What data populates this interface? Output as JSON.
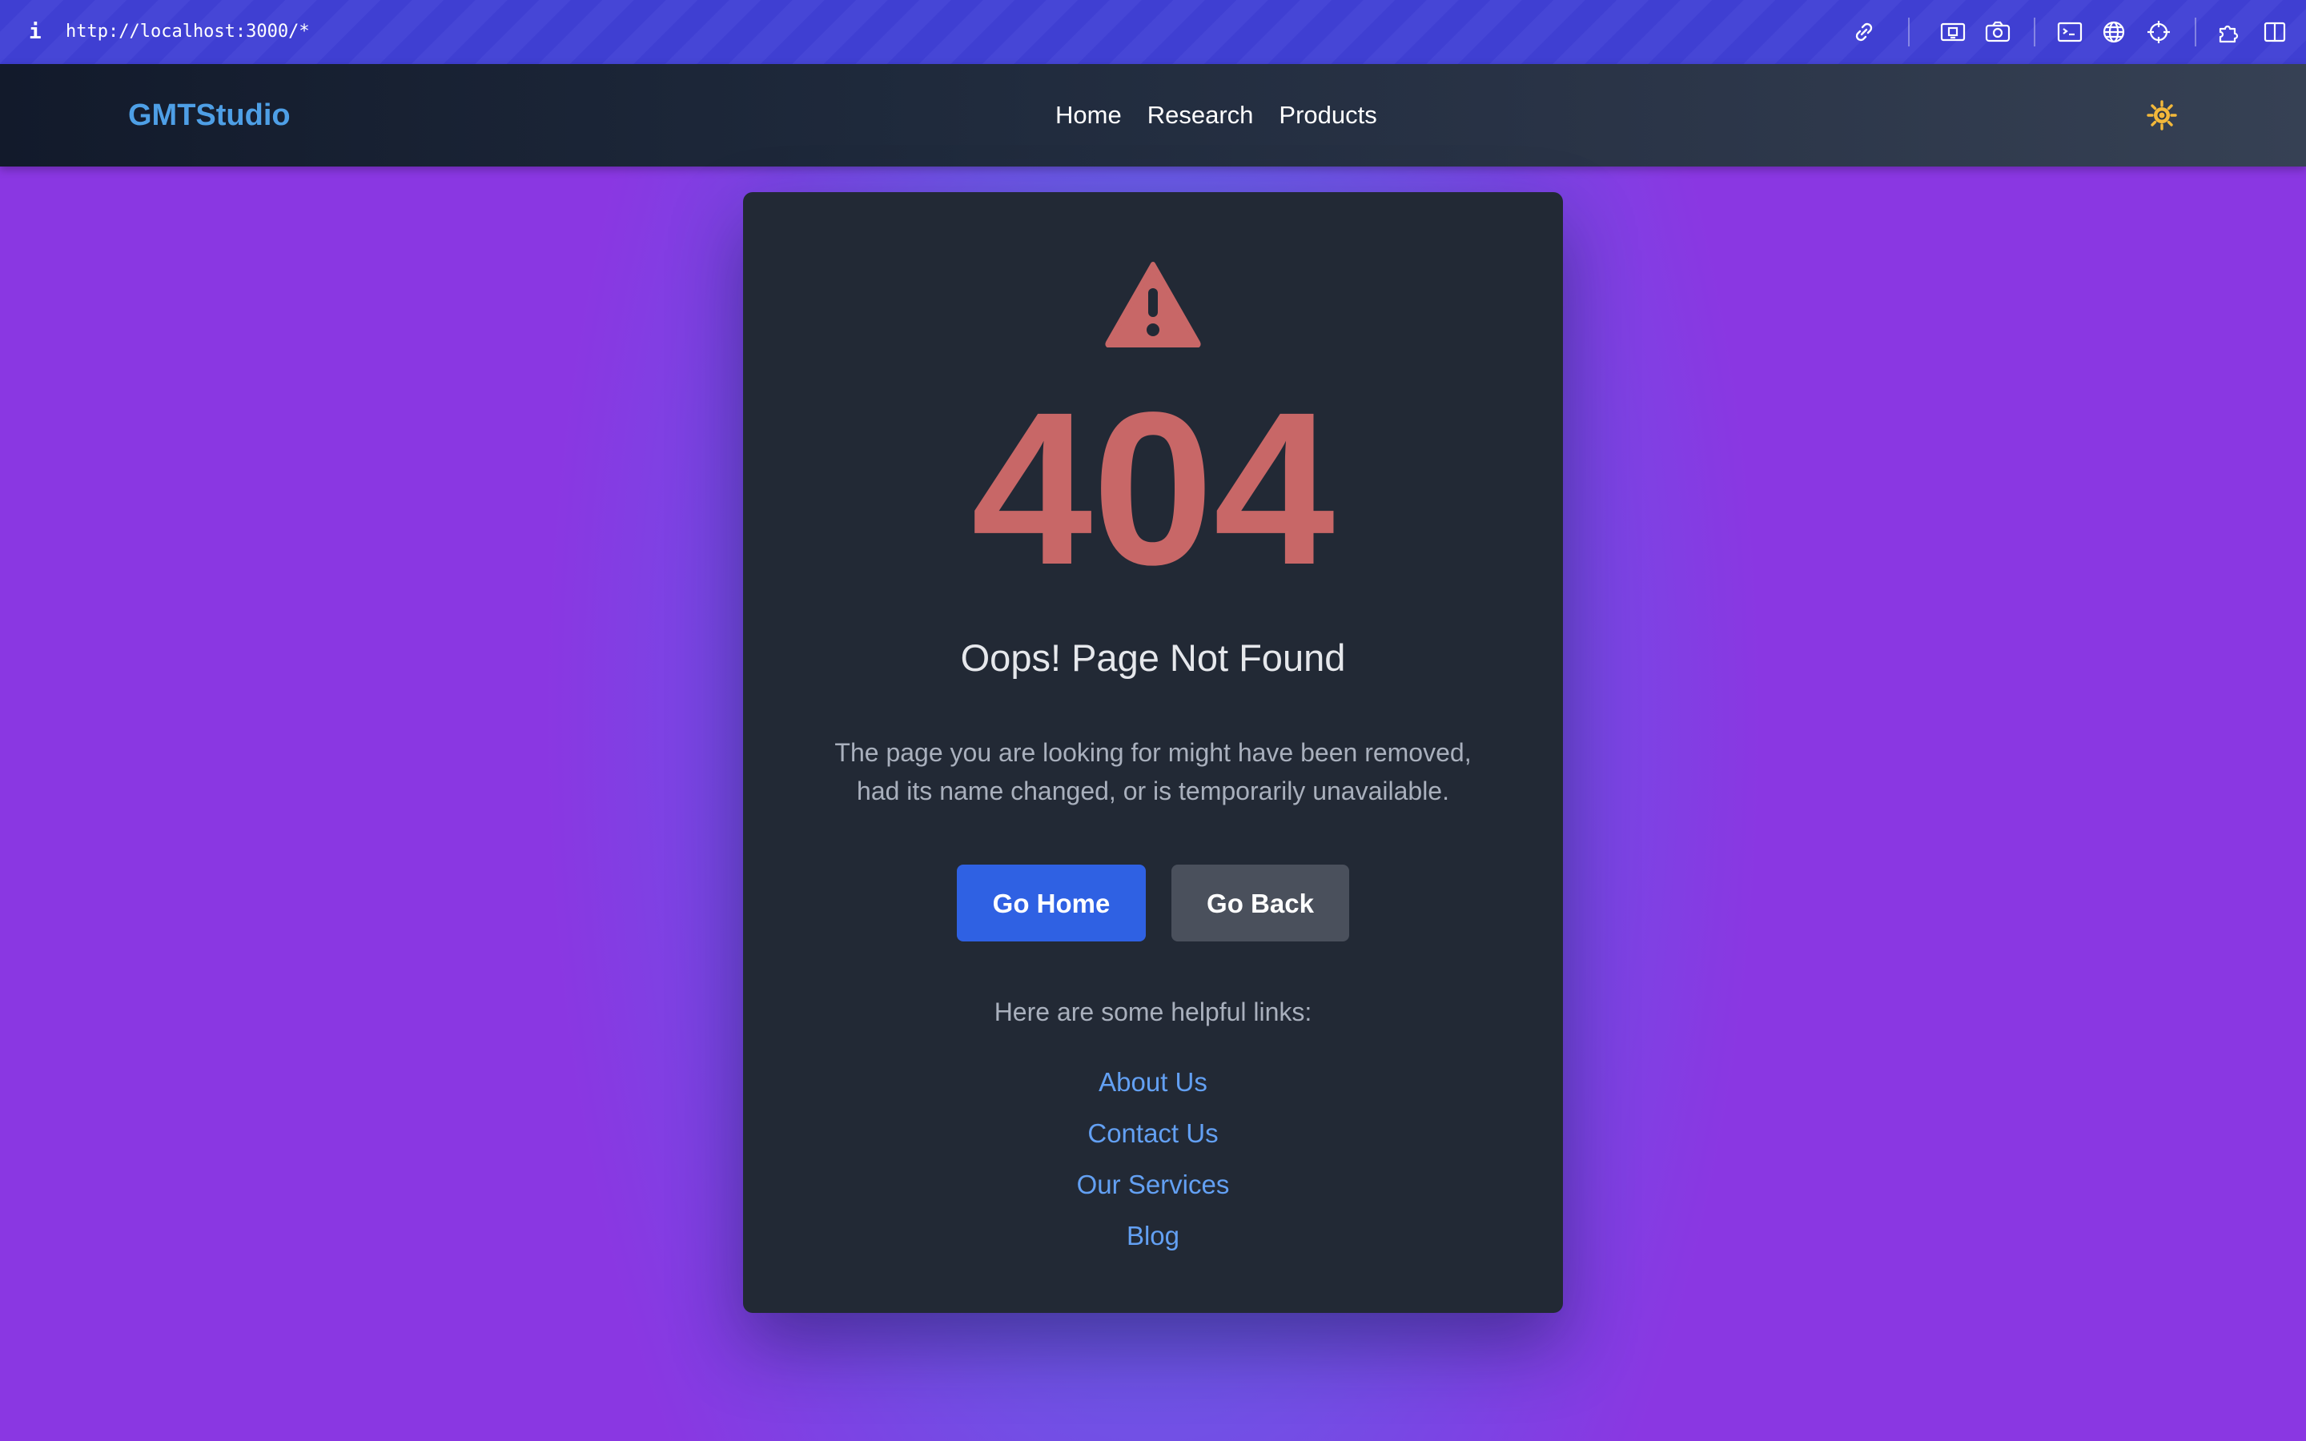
{
  "browser": {
    "url": "http://localhost:3000/*",
    "toolbar_icons": [
      "link-icon",
      "responsive-icon",
      "camera-icon",
      "terminal-icon",
      "globe-icon",
      "crosshair-icon",
      "extensions-icon",
      "split-view-icon"
    ]
  },
  "nav": {
    "logo": "GMTStudio",
    "links": [
      {
        "label": "Home"
      },
      {
        "label": "Research"
      },
      {
        "label": "Products"
      }
    ],
    "theme_icon": "sun-icon"
  },
  "error": {
    "icon": "warning-icon",
    "code": "404",
    "title": "Oops! Page Not Found",
    "description": "The page you are looking for might have been removed, had its name changed, or is temporarily unavailable.",
    "primary_button": "Go Home",
    "secondary_button": "Go Back",
    "helpful_label": "Here are some helpful links:",
    "helpful_links": [
      {
        "label": "About Us"
      },
      {
        "label": "Contact Us"
      },
      {
        "label": "Our Services"
      },
      {
        "label": "Blog"
      }
    ]
  },
  "colors": {
    "accent": "#2f61e3",
    "error": "#c86767",
    "link": "#63a0f3",
    "card": "#222935",
    "logo": "#4e9fe6",
    "sun": "#f3b83a"
  }
}
